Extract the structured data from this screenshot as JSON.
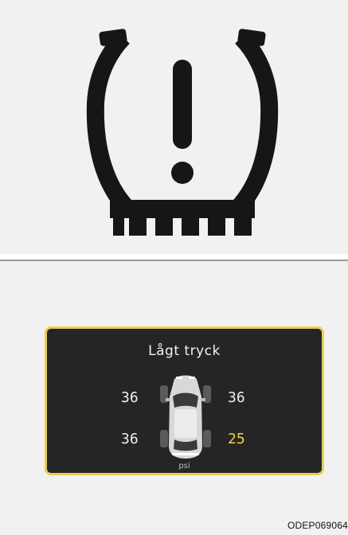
{
  "top_panel": {
    "icon": "tpms-low-pressure-warning-icon"
  },
  "display": {
    "title": "Lågt tryck",
    "unit": "psi",
    "tires": {
      "front_left": "36",
      "front_right": "36",
      "rear_left": "36",
      "rear_right": "25"
    },
    "low_tire": "rear_right",
    "colors": {
      "border": "#e6cf52",
      "background": "#252525",
      "low_value": "#f3d23a",
      "normal_value": "#f0f0f0"
    }
  },
  "figure_code": "ODEP069064"
}
